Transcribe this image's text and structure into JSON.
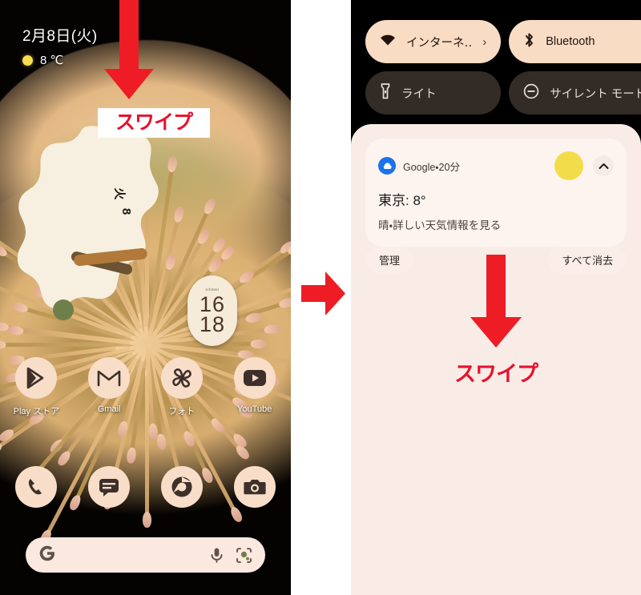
{
  "left_phone": {
    "status": {
      "date": "2月8日(火)",
      "temperature": "8 ℃",
      "weather_icon": "sun-icon"
    },
    "clock_widget": {
      "day_label": "火",
      "date_number": "8"
    },
    "digital_clock": {
      "brand": "citizen",
      "hours": "16",
      "minutes": "18"
    },
    "apps": [
      {
        "label": "Play ストア",
        "icon": "play-store-icon"
      },
      {
        "label": "Gmail",
        "icon": "gmail-icon"
      },
      {
        "label": "フォト",
        "icon": "google-photos-icon"
      },
      {
        "label": "YouTube",
        "icon": "youtube-icon"
      }
    ],
    "dock": [
      {
        "label": "電話",
        "icon": "phone-icon"
      },
      {
        "label": "メッセージ",
        "icon": "messages-icon"
      },
      {
        "label": "Chrome",
        "icon": "chrome-icon"
      },
      {
        "label": "カメラ",
        "icon": "camera-icon"
      }
    ],
    "search_bar": {
      "logo": "google-g-icon",
      "mic_icon": "microphone-icon",
      "lens_icon": "google-lens-icon",
      "placeholder": ""
    },
    "annotation": {
      "arrow": "arrow-down",
      "label": "スワイプ"
    }
  },
  "transition": {
    "arrow": "arrow-right"
  },
  "right_phone": {
    "quick_settings": [
      {
        "label": "インターネ‥",
        "icon": "wifi-icon",
        "state": "on",
        "chevron": "›"
      },
      {
        "label": "Bluetooth",
        "icon": "bluetooth-icon",
        "state": "on",
        "chevron": ""
      },
      {
        "label": "ライト",
        "icon": "flashlight-icon",
        "state": "off",
        "chevron": ""
      },
      {
        "label": "サイレント モード",
        "icon": "do-not-disturb-icon",
        "state": "off",
        "chevron": ""
      }
    ],
    "notification": {
      "source": "Google・20分",
      "app_icon": "google-weather-icon",
      "title": "東京: 8°",
      "subtitle": "晴・詳しい天気情報を見る",
      "weather_icon": "sun-icon",
      "collapse_icon": "chevron-up-icon"
    },
    "actions": {
      "manage": "管理",
      "clear_all": "すべて消去"
    },
    "annotation": {
      "arrow": "arrow-down",
      "label": "スワイプ"
    }
  },
  "colors": {
    "accent_red": "#e8112d",
    "tile_on": "#f9dcc4",
    "tile_off": "#332b25",
    "shade_bg": "#f9ece7",
    "icon_bg": "#f8ddc8",
    "sun_yellow": "#f3dc4a",
    "google_blue": "#1a73e8"
  }
}
